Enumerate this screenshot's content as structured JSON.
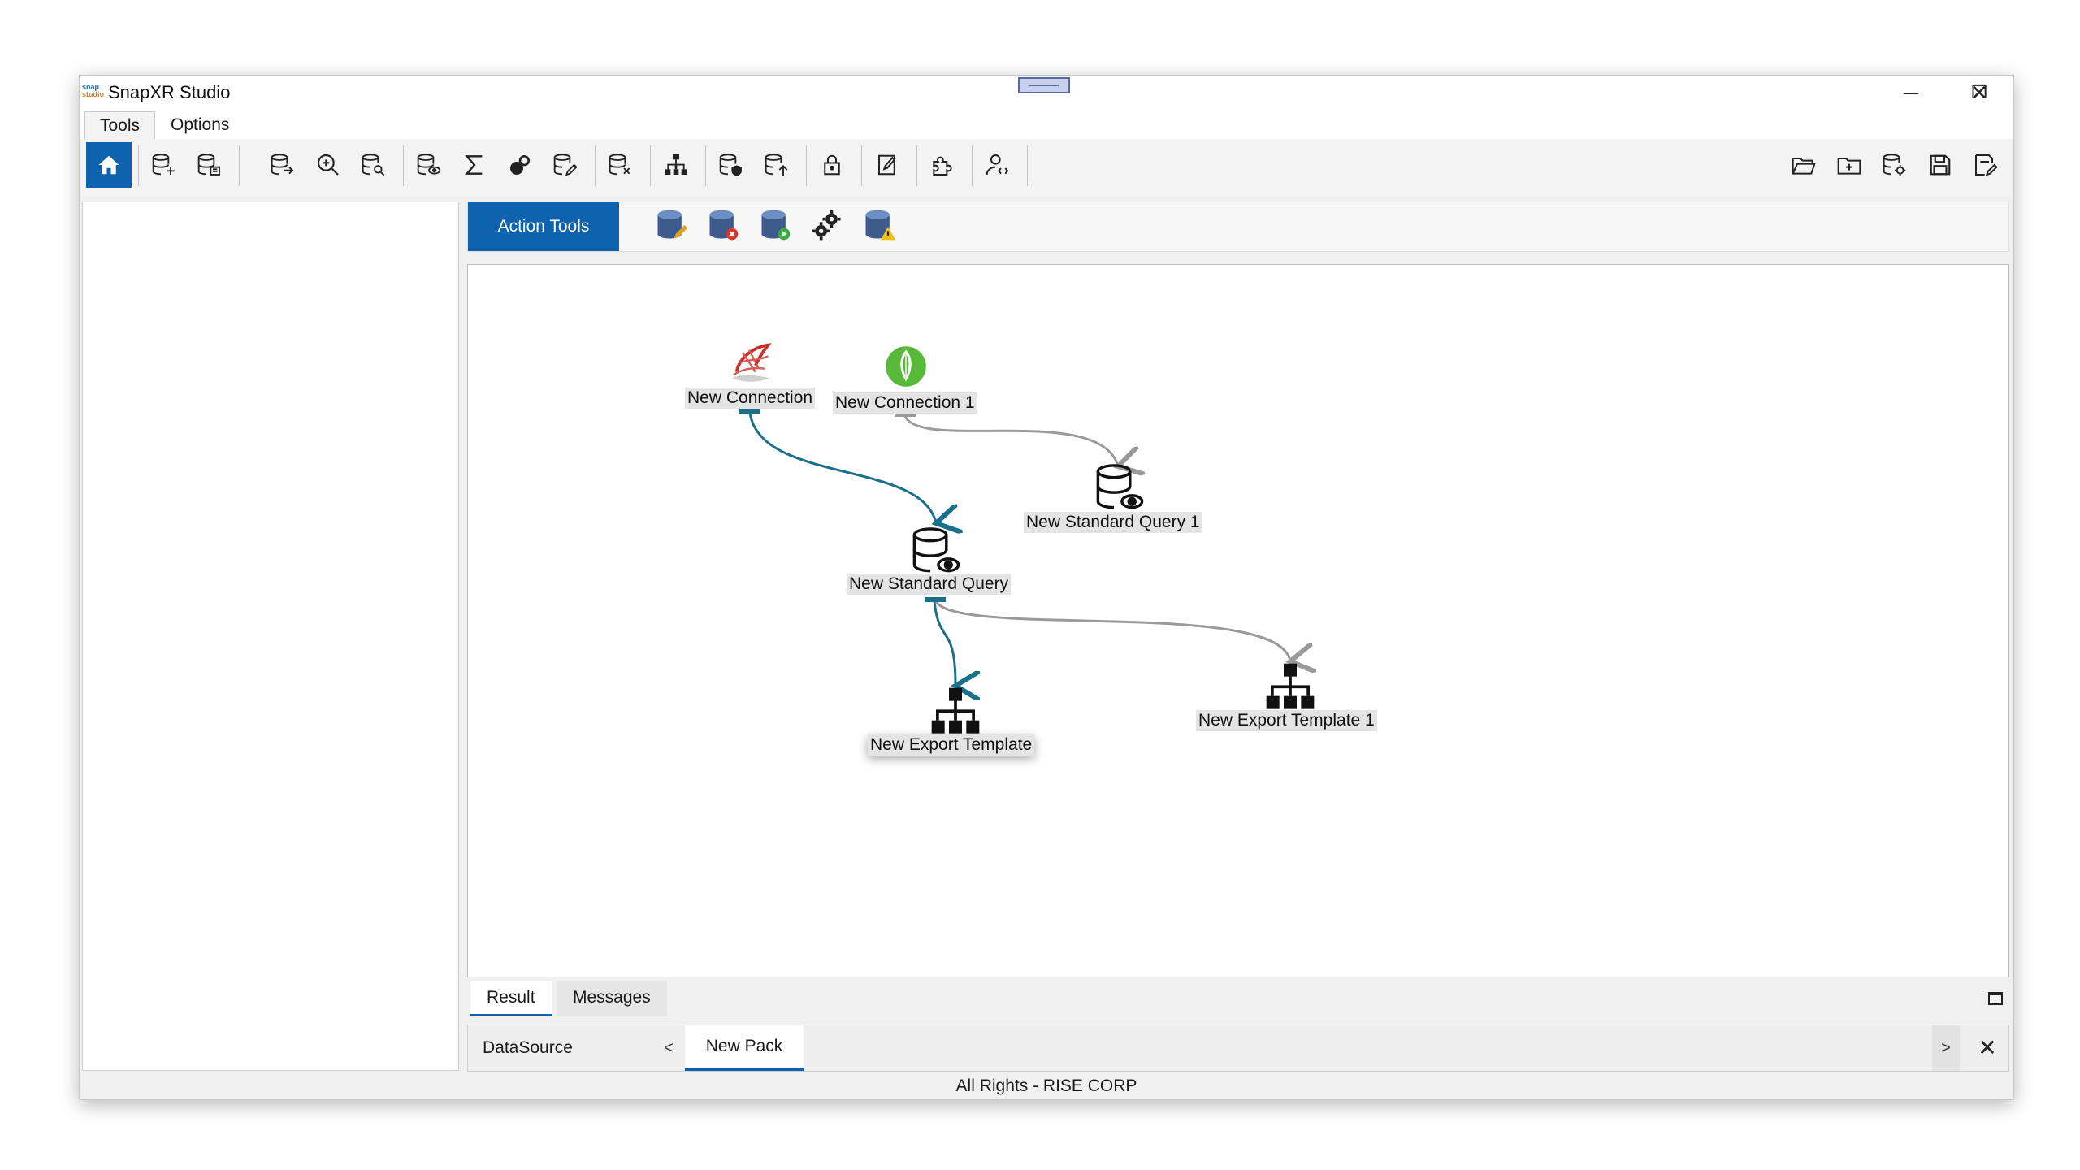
{
  "window": {
    "title": "SnapXR Studio",
    "logo_text_top": "snap",
    "logo_text_bottom": "studio",
    "minimize": "─",
    "restore": "❐",
    "close": "✕"
  },
  "menu": {
    "tabs": [
      {
        "label": "Tools"
      },
      {
        "label": "Options"
      }
    ]
  },
  "toolbar": {
    "left_icons": [
      "home-icon",
      "add-database-icon",
      "database-settings-icon",
      "database-export-icon",
      "zoom-search-icon",
      "database-search-icon",
      "database-view-icon",
      "sum-icon",
      "link-icon",
      "database-edit-icon",
      "database-delete-icon",
      "hierarchy-icon",
      "database-shield-icon",
      "database-upload-icon",
      "lock-icon",
      "note-edit-icon",
      "plugin-icon",
      "user-code-icon"
    ],
    "right_icons": [
      "folder-open-icon",
      "folder-add-icon",
      "database-gear-icon",
      "save-icon",
      "save-as-icon"
    ]
  },
  "action_tools": {
    "label": "Action Tools",
    "icons": [
      "db-edit-action-icon",
      "db-delete-action-icon",
      "db-run-action-icon",
      "gears-action-icon",
      "db-warning-action-icon"
    ]
  },
  "canvas": {
    "nodes": [
      {
        "id": "conn",
        "label": "New Connection",
        "icon": "sql-server-icon"
      },
      {
        "id": "conn1",
        "label": "New Connection 1",
        "icon": "mongodb-leaf-icon"
      },
      {
        "id": "q1",
        "label": "New Standard Query 1",
        "icon": "query-icon"
      },
      {
        "id": "q",
        "label": "New Standard Query",
        "icon": "query-icon"
      },
      {
        "id": "et",
        "label": "New Export Template",
        "icon": "export-template-icon"
      },
      {
        "id": "et1",
        "label": "New Export Template 1",
        "icon": "export-template-icon"
      }
    ],
    "link_color_active": "#1a6f8a",
    "link_color_inactive": "#9a9a9a"
  },
  "result_tabs": [
    {
      "label": "Result"
    },
    {
      "label": "Messages"
    }
  ],
  "bottom": {
    "datasource_label": "DataSource",
    "prev": "<",
    "next": ">",
    "pack_tab": "New Pack",
    "close": "✕"
  },
  "status": "All Rights - RISE CORP",
  "colors": {
    "accent": "#0e62ae"
  }
}
